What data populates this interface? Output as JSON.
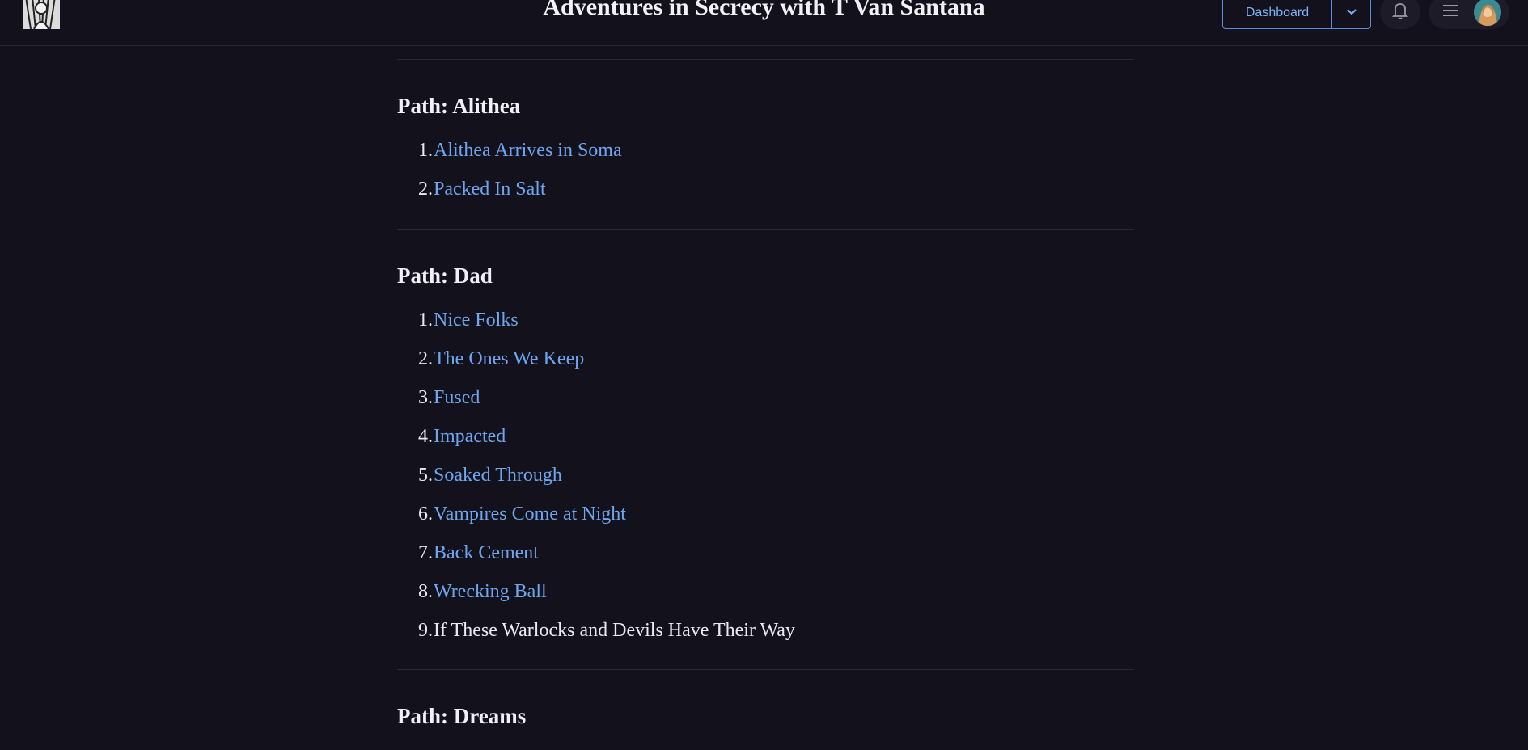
{
  "header": {
    "title": "Adventures in Secrecy with T Van Santana",
    "dashboard_label": "Dashboard"
  },
  "colors": {
    "background": "#13111c",
    "link": "#6ea7ef",
    "accent_border": "#5b8fd6",
    "text": "#e9e7f0"
  },
  "icons": {
    "logo": "site-logo-icon",
    "dropdown": "chevron-down-icon",
    "notifications": "bell-icon",
    "menu": "hamburger-menu-icon",
    "avatar": "user-avatar"
  },
  "sections": [
    {
      "title": "Path: Alithea",
      "items": [
        {
          "num": "1.",
          "label": "Alithea Arrives in Soma",
          "link": true
        },
        {
          "num": "2.",
          "label": "Packed In Salt",
          "link": true
        }
      ]
    },
    {
      "title": "Path: Dad",
      "items": [
        {
          "num": "1.",
          "label": "Nice Folks",
          "link": true
        },
        {
          "num": "2.",
          "label": "The Ones We Keep",
          "link": true
        },
        {
          "num": "3.",
          "label": "Fused",
          "link": true
        },
        {
          "num": "4.",
          "label": "Impacted",
          "link": true
        },
        {
          "num": "5.",
          "label": "Soaked Through",
          "link": true
        },
        {
          "num": "6.",
          "label": "Vampires Come at Night",
          "link": true
        },
        {
          "num": "7.",
          "label": "Back Cement",
          "link": true
        },
        {
          "num": "8.",
          "label": "Wrecking Ball",
          "link": true
        },
        {
          "num": "9.",
          "label": "If These Warlocks and Devils Have Their Way",
          "link": false
        }
      ]
    },
    {
      "title": "Path: Dreams",
      "items": []
    }
  ]
}
